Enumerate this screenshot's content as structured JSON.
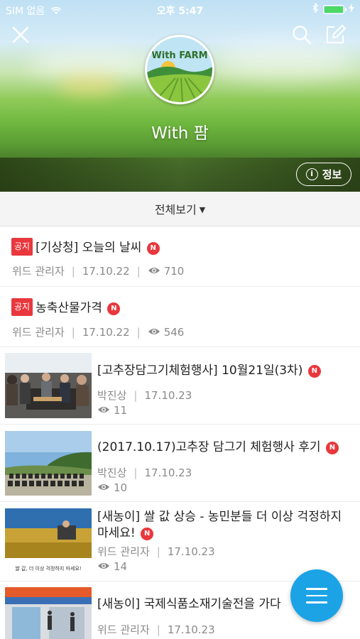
{
  "status_bar": {
    "carrier": "SIM 없음",
    "time": "오후 5:47"
  },
  "header": {
    "club_name": "With 팜",
    "logo_text": "With FARM",
    "info_label": "정보",
    "info_icon": "info-circle-icon",
    "close_icon": "close-icon",
    "search_icon": "search-icon",
    "write_icon": "write-icon"
  },
  "filter": {
    "label": "전체보기"
  },
  "badges": {
    "notice": "공지",
    "new": "N"
  },
  "notice_posts": [
    {
      "title": "[기상청] 오늘의 날씨",
      "author": "위드 관리자",
      "date": "17.10.22",
      "views": "710"
    },
    {
      "title": "농축산물가격",
      "author": "위드 관리자",
      "date": "17.10.22",
      "views": "546"
    }
  ],
  "image_posts": [
    {
      "title": "[고추장담그기체험행사] 10월21일(3차)",
      "author": "박진상",
      "date": "17.10.23",
      "views": "11"
    },
    {
      "title": "(2017.10.17)고추장 담그기 체험행사 후기",
      "author": "박진상",
      "date": "17.10.23",
      "views": "10"
    },
    {
      "title": "[새농이] 쌀 값 상승 - 농민분들 더 이상 걱정하지 마세요!",
      "author": "위드 관리자",
      "date": "17.10.23",
      "views": "14",
      "thumb_caption": "쌀 값, 더 이상 걱정하지 마세요!"
    },
    {
      "title": "[새농이] 국제식품소재기술전을 가다",
      "author": "위드 관리자",
      "date": "17.10.23",
      "views": ""
    }
  ],
  "colors": {
    "accent": "#1ba3e6",
    "badge_red": "#e8383d",
    "battery_green": "#4cd964"
  }
}
